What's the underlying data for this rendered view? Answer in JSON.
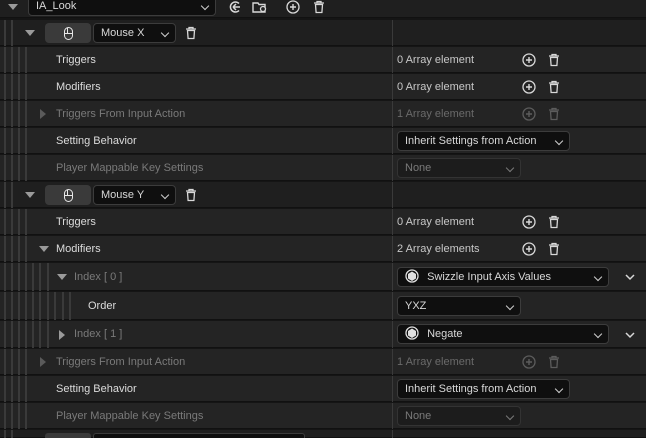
{
  "top": {
    "asset_combo": "IA_Look"
  },
  "mappings": [
    {
      "key_label": "Mouse X",
      "triggers_label": "Triggers",
      "triggers_value": "0 Array element",
      "modifiers_label": "Modifiers",
      "modifiers_value": "0 Array element",
      "tfia_label": "Triggers From Input Action",
      "tfia_value": "1 Array element",
      "sb_label": "Setting Behavior",
      "sb_value": "Inherit Settings from Action",
      "pmks_label": "Player Mappable Key Settings",
      "pmks_value": "None"
    },
    {
      "key_label": "Mouse Y",
      "triggers_label": "Triggers",
      "triggers_value": "0 Array element",
      "modifiers_label": "Modifiers",
      "modifiers_value": "2 Array elements",
      "index0_label": "Index [ 0 ]",
      "index0_value": "Swizzle Input Axis Values",
      "order_label": "Order",
      "order_value": "YXZ",
      "index1_label": "Index [ 1 ]",
      "index1_value": "Negate",
      "tfia_label": "Triggers From Input Action",
      "tfia_value": "1 Array element",
      "sb_label": "Setting Behavior",
      "sb_value": "Inherit Settings from Action",
      "pmks_label": "Player Mappable Key Settings",
      "pmks_value": "None"
    }
  ],
  "colors": {
    "row_bg": "#242424",
    "header_bg": "#1f1f1f",
    "divider": "#3a3a3a",
    "text": "#dcdcdc",
    "dim_text": "#7a7a7a"
  }
}
